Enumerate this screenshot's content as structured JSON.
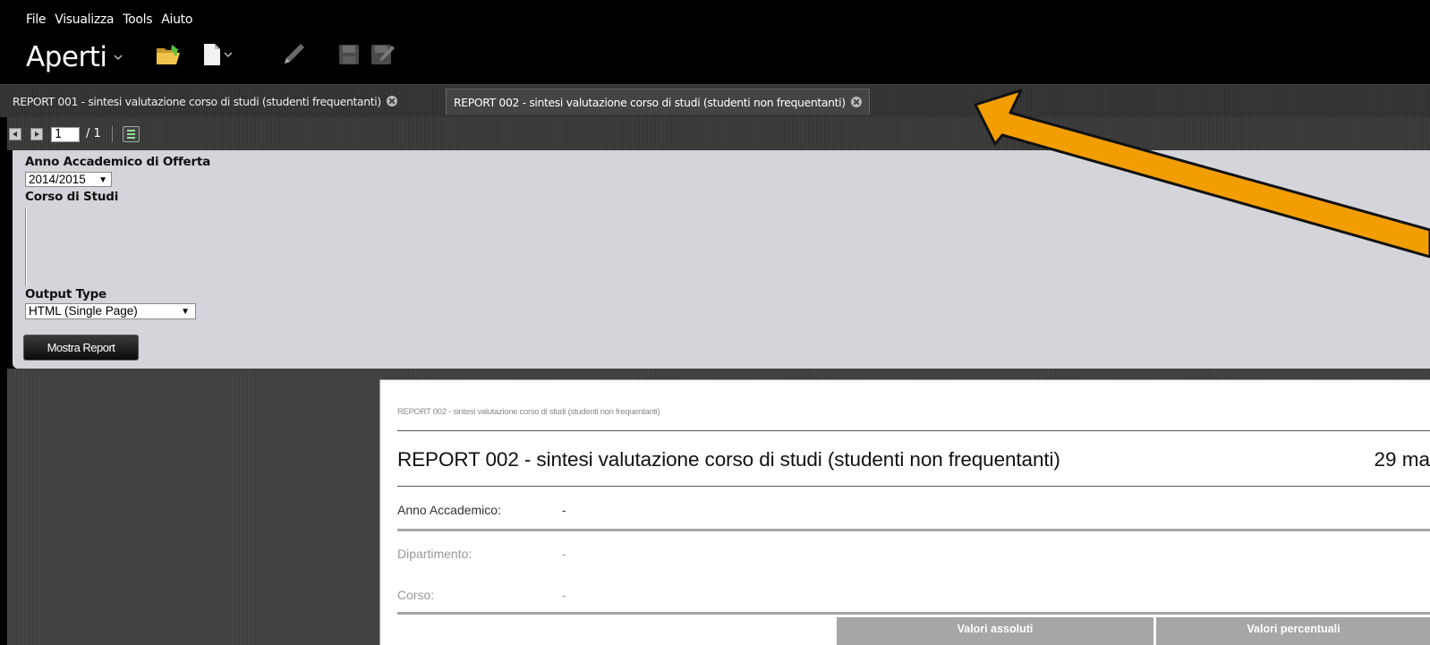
{
  "menu": {
    "items": [
      "File",
      "Visualizza",
      "Tools",
      "Aiuto"
    ]
  },
  "toolbar": {
    "title": "Aperti",
    "icons": [
      "chevron-down-icon",
      "open-folder-icon",
      "new-document-icon",
      "edit-pencil-icon",
      "save-icon",
      "save-as-icon"
    ]
  },
  "tabs": [
    {
      "label": "REPORT 001 - sintesi valutazione corso di studi (studenti frequentanti)",
      "active": false
    },
    {
      "label": "REPORT 002 - sintesi valutazione corso di studi (studenti non frequentanti)",
      "active": true
    }
  ],
  "pager": {
    "current_page": "1",
    "total": "/ 1"
  },
  "parameters": {
    "anno_label": "Anno Accademico di Offerta",
    "anno_value": "2014/2015",
    "corso_label": "Corso di Studi",
    "output_label": "Output Type",
    "output_value": "HTML (Single Page)",
    "submit_label": "Mostra Report"
  },
  "report": {
    "breadcrumb": "REPORT 002 - sintesi valutazione corso di studi (studenti non frequentanti)",
    "title": "REPORT 002 - sintesi valutazione corso di studi (studenti non frequentanti)",
    "date": "29 ma",
    "fields": [
      {
        "label": "Anno Accademico:",
        "value": "-"
      },
      {
        "label": "Dipartimento:",
        "value": "-"
      },
      {
        "label": "Corso:",
        "value": "-"
      }
    ],
    "table_headers": [
      "Valori assoluti",
      "Valori percentuali"
    ]
  },
  "colors": {
    "annotation_arrow": "#f29e00",
    "panel_background": "#d4d5da",
    "table_header": "#a6a6a6"
  }
}
